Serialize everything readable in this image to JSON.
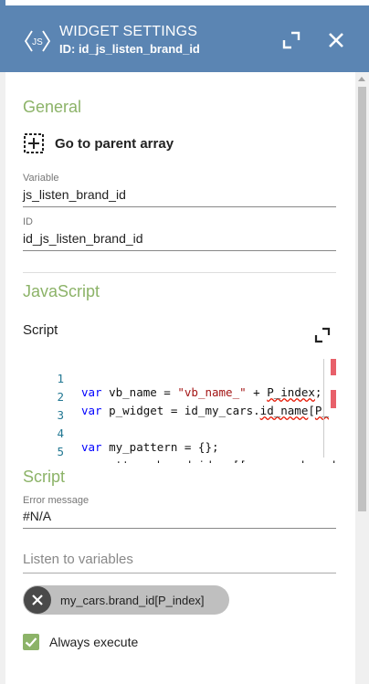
{
  "header": {
    "title": "WIDGET SETTINGS",
    "subtitle": "ID: id_js_listen_brand_id",
    "logo_text": "JS"
  },
  "general": {
    "section_title": "General",
    "goto_parent_label": "Go to parent array",
    "variable": {
      "label": "Variable",
      "value": "js_listen_brand_id"
    },
    "id": {
      "label": "ID",
      "value": "id_js_listen_brand_id"
    }
  },
  "javascript": {
    "section_title": "JavaScript",
    "script_label": "Script",
    "code_lines": [
      {
        "num": "1",
        "text": "var vb_name = \"vb_name_\" + P_index;"
      },
      {
        "num": "2",
        "text": "var p_widget = id_my_cars.id_name[P_"
      },
      {
        "num": "3",
        "text": ""
      },
      {
        "num": "4",
        "text": "var my_pattern = {};"
      },
      {
        "num": "5",
        "text": "my_pattern.brand_id = [[my_cars.brand"
      }
    ]
  },
  "script_section": {
    "section_title": "Script",
    "error": {
      "label": "Error message",
      "value": "#N/A"
    },
    "listen_placeholder": "Listen to variables",
    "chip_label": "my_cars.brand_id[P_index]",
    "always_execute_label": "Always execute",
    "always_execute_checked": true
  },
  "colors": {
    "header_bg": "#5b85b3",
    "section_green": "#8cb368",
    "chip_bg": "#bfbfbf"
  }
}
